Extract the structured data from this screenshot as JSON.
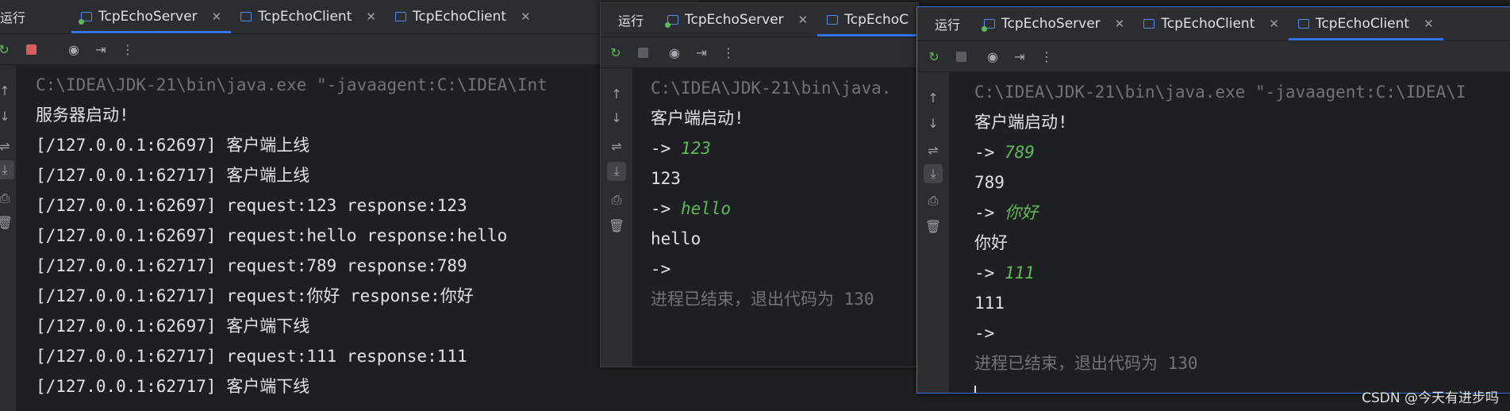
{
  "window1": {
    "run_label": "运行",
    "tabs": [
      {
        "label": "TcpEchoServer",
        "active": true
      },
      {
        "label": "TcpEchoClient",
        "active": false
      },
      {
        "label": "TcpEchoClient",
        "active": false
      }
    ],
    "command": "C:\\IDEA\\JDK-21\\bin\\java.exe \"-javaagent:C:\\IDEA\\Int",
    "lines": [
      "服务器启动!",
      "[/127.0.0.1:62697] 客户端上线",
      "[/127.0.0.1:62717] 客户端上线",
      "[/127.0.0.1:62697] request:123 response:123",
      "[/127.0.0.1:62697] request:hello response:hello",
      "[/127.0.0.1:62717] request:789 response:789",
      "[/127.0.0.1:62717] request:你好 response:你好",
      "[/127.0.0.1:62697] 客户端下线",
      "[/127.0.0.1:62717] request:111 response:111",
      "[/127.0.0.1:62717] 客户端下线"
    ]
  },
  "window2": {
    "run_label": "运行",
    "tabs": [
      {
        "label": "TcpEchoServer",
        "active": false
      },
      {
        "label": "TcpEchoC",
        "active": true
      }
    ],
    "command": "C:\\IDEA\\JDK-21\\bin\\java.",
    "started": "客户端启动!",
    "prompt": "->",
    "exchanges": [
      {
        "input": "123",
        "output": "123"
      },
      {
        "input": "hello",
        "output": "hello"
      }
    ],
    "exit": "进程已结束，退出代码为 130"
  },
  "window3": {
    "run_label": "运行",
    "tabs": [
      {
        "label": "TcpEchoServer",
        "active": false
      },
      {
        "label": "TcpEchoClient",
        "active": false
      },
      {
        "label": "TcpEchoClient",
        "active": true
      }
    ],
    "command": "C:\\IDEA\\JDK-21\\bin\\java.exe \"-javaagent:C:\\IDEA\\I",
    "started": "客户端启动!",
    "prompt": "->",
    "exchanges": [
      {
        "input": "789",
        "output": "789"
      },
      {
        "input": "你好",
        "output": "你好"
      },
      {
        "input": "111",
        "output": "111"
      }
    ],
    "exit": "进程已结束，退出代码为 130"
  },
  "watermark": "CSDN @今天有进步吗",
  "colors": {
    "accent": "#3574f0",
    "input_green": "#5fb85a",
    "stop_red": "#db5c5c",
    "bg": "#1e1f22",
    "chrome": "#2b2d30"
  }
}
